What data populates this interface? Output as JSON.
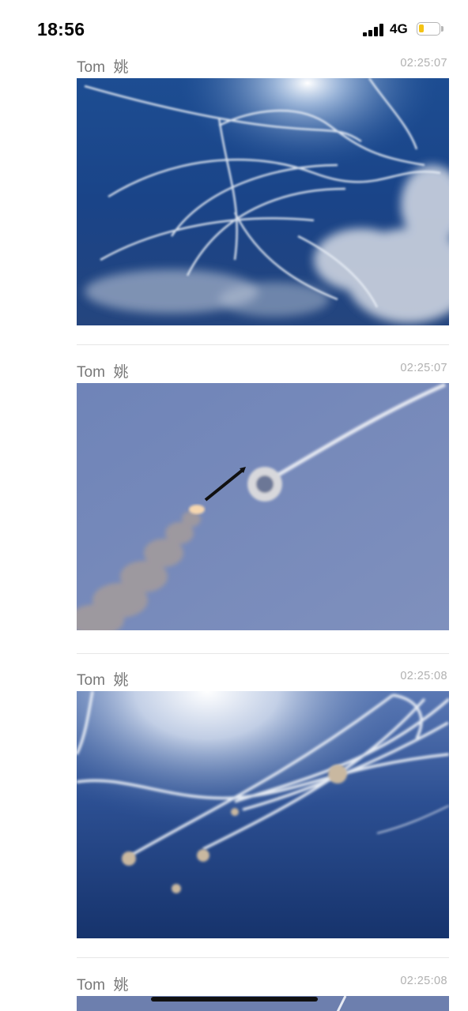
{
  "status_bar": {
    "time": "18:56",
    "network": "4G",
    "signal_bars": 4,
    "battery_level": 0.2,
    "battery_color": "#f4c314"
  },
  "posts": [
    {
      "author": "Tom  姚",
      "time": "02:25:07",
      "image_icon": "photo-missile-trails-dark-sky"
    },
    {
      "author": "Tom  姚",
      "time": "02:25:07",
      "image_icon": "photo-rocket-launch-interception"
    },
    {
      "author": "Tom  姚",
      "time": "02:25:08",
      "image_icon": "photo-interceptor-explosions"
    },
    {
      "author": "Tom  姚",
      "time": "02:25:08",
      "image_icon": "photo-partial"
    }
  ]
}
